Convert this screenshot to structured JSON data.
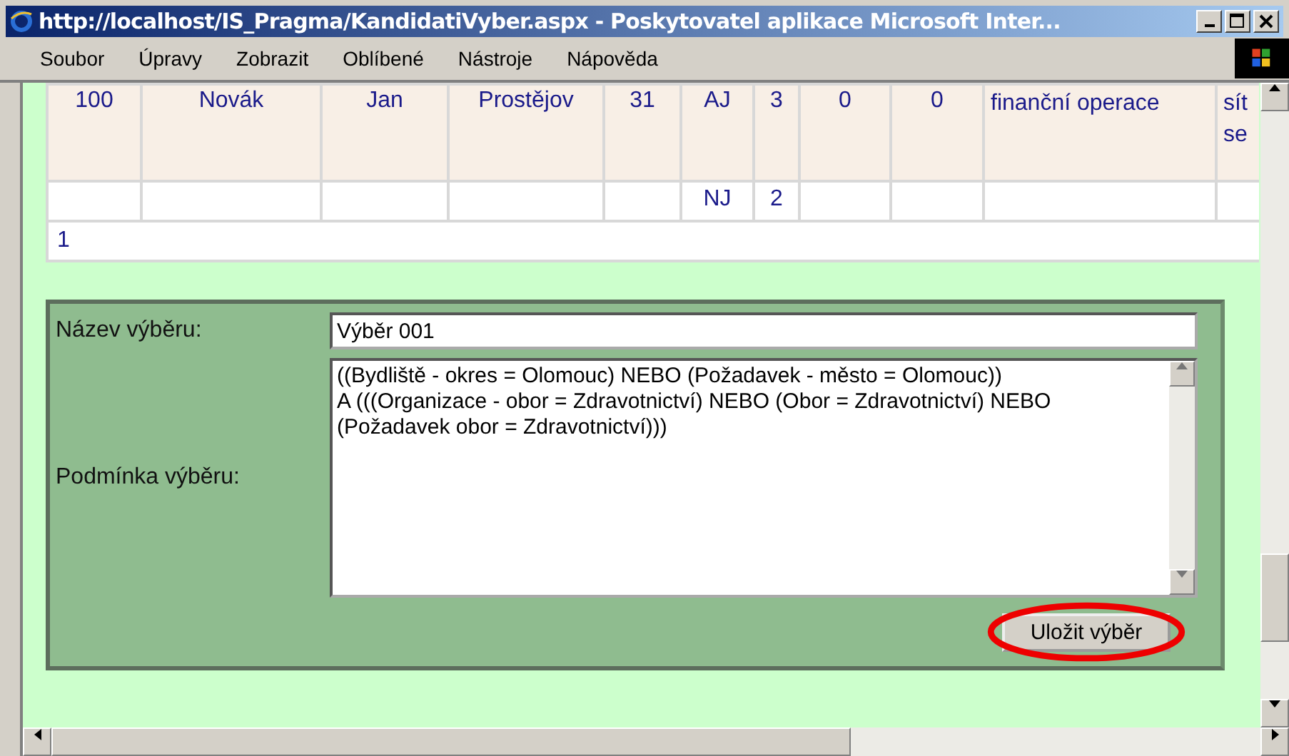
{
  "window": {
    "title": "http://localhost/IS_Pragma/KandidatiVyber.aspx - Poskytovatel aplikace Microsoft Inter..."
  },
  "menu": [
    "Soubor",
    "Úpravy",
    "Zobrazit",
    "Oblíbené",
    "Nástroje",
    "Nápověda"
  ],
  "table": {
    "rows": [
      {
        "cells": [
          "100",
          "Novák",
          "Jan",
          "Prostějov",
          "31",
          "AJ",
          "3",
          "0",
          "0",
          "finanční operace",
          "sít se"
        ]
      },
      {
        "cells": [
          "",
          "",
          "",
          "",
          "",
          "NJ",
          "2",
          "",
          "",
          "",
          ""
        ]
      }
    ],
    "pager": "1"
  },
  "form": {
    "name_label": "Název výběru:",
    "name_value": "Výběr 001",
    "condition_label": "Podmínka výběru:",
    "condition_lines": [
      "((Bydliště - okres = Olomouc) NEBO (Požadavek - město = Olomouc))",
      "A (((Organizace - obor = Zdravotnictví) NEBO (Obor = Zdravotnictví) NEBO (Požadavek obor = Zdravotnictví)))"
    ],
    "save_button": {
      "label": "Uložit výběr",
      "highlighted": true
    }
  }
}
